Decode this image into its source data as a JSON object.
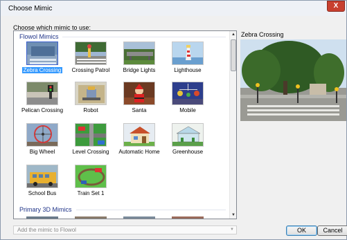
{
  "window": {
    "title": "Choose Mimic",
    "close_glyph": "X"
  },
  "chooser": {
    "label": "Choose which mimic to use:",
    "groups": [
      {
        "title": "Flowol Mimics",
        "items": [
          {
            "label": "Zebra Crossing",
            "selected": true
          },
          {
            "label": "Crossing Patrol"
          },
          {
            "label": "Bridge Lights"
          },
          {
            "label": "Lighthouse"
          },
          {
            "label": "Pelican Crossing"
          },
          {
            "label": "Robot"
          },
          {
            "label": "Santa"
          },
          {
            "label": "Mobile"
          },
          {
            "label": "Big Wheel"
          },
          {
            "label": "Level Crossing"
          },
          {
            "label": "Automatic Home"
          },
          {
            "label": "Greenhouse"
          },
          {
            "label": "School Bus"
          },
          {
            "label": "Train Set 1"
          }
        ]
      },
      {
        "title": "Primary 3D Mimics"
      }
    ]
  },
  "scrollbar": {
    "up_glyph": "▲",
    "down_glyph": "▼"
  },
  "preview": {
    "title": "Zebra Crossing"
  },
  "add_combo": {
    "placeholder": "Add the mimic to Flowol",
    "arrow_glyph": "▼"
  },
  "buttons": {
    "ok": "OK",
    "cancel": "Cancel"
  }
}
